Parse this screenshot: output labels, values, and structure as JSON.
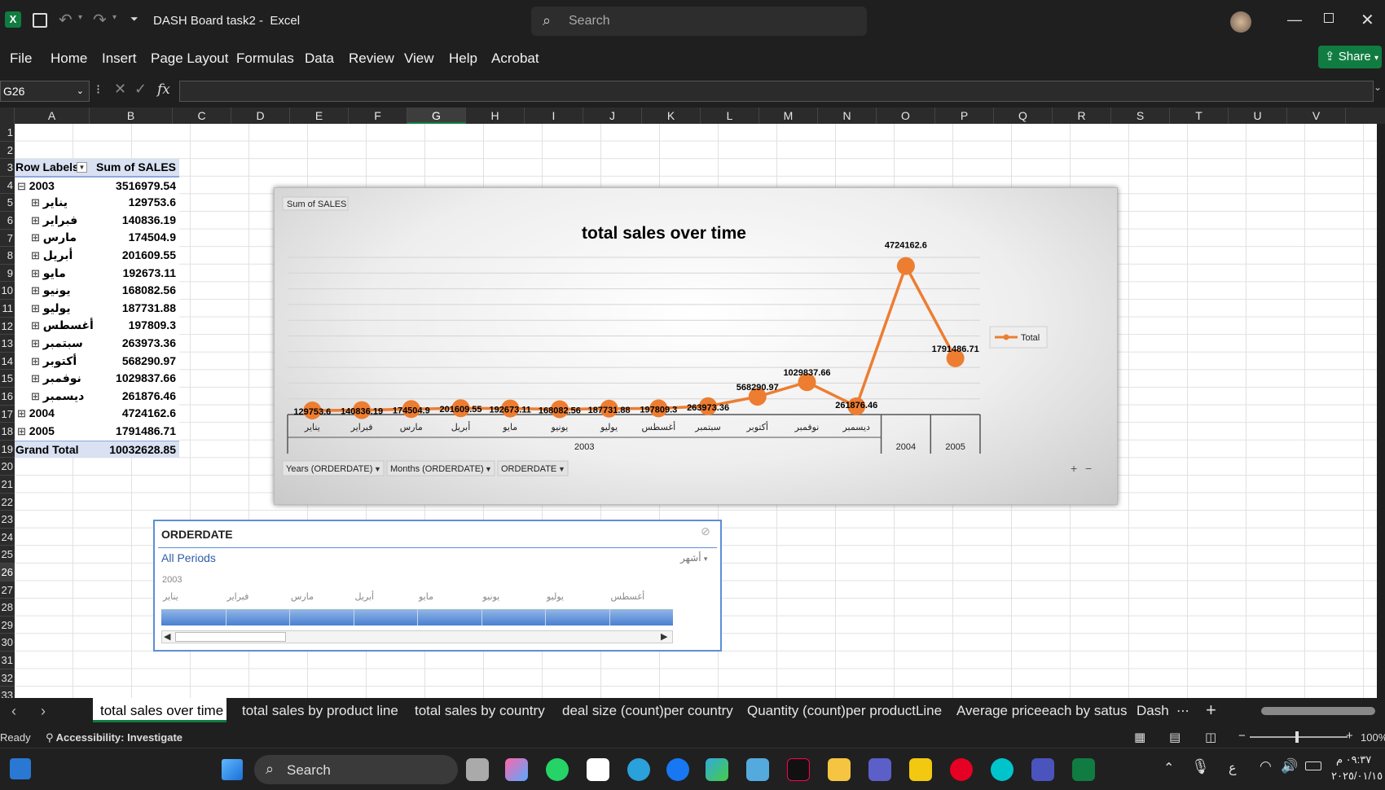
{
  "window": {
    "doc_title": "DASH Board task2",
    "app_name": "Excel",
    "search_placeholder": "Search",
    "share_label": "Share"
  },
  "ribbon": {
    "tabs": [
      "File",
      "Home",
      "Insert",
      "Page Layout",
      "Formulas",
      "Data",
      "Review",
      "View",
      "Help",
      "Acrobat"
    ]
  },
  "formula_bar": {
    "name_box": "G26",
    "fx_label": "fx",
    "value": ""
  },
  "columns": [
    "A",
    "B",
    "C",
    "D",
    "E",
    "F",
    "G",
    "H",
    "I",
    "J",
    "K",
    "L",
    "M",
    "N",
    "O",
    "P",
    "Q",
    "R",
    "S",
    "T",
    "U",
    "V"
  ],
  "selected_column": "G",
  "rows": [
    "1",
    "2",
    "3",
    "4",
    "5",
    "6",
    "7",
    "8",
    "9",
    "10",
    "11",
    "12",
    "13",
    "14",
    "15",
    "16",
    "17",
    "18",
    "19",
    "20",
    "21",
    "22",
    "23",
    "24",
    "25",
    "26",
    "27",
    "28",
    "29",
    "30",
    "31",
    "32",
    "33"
  ],
  "pivot": {
    "header_label": "Row Labels",
    "header_value": "Sum of SALES",
    "rows": [
      {
        "label": "2003",
        "value": "3516979.54",
        "level": 0,
        "toggle": "⊟"
      },
      {
        "label": "يناير",
        "value": "129753.6",
        "level": 1,
        "toggle": "⊞"
      },
      {
        "label": "فبراير",
        "value": "140836.19",
        "level": 1,
        "toggle": "⊞"
      },
      {
        "label": "مارس",
        "value": "174504.9",
        "level": 1,
        "toggle": "⊞"
      },
      {
        "label": "أبريل",
        "value": "201609.55",
        "level": 1,
        "toggle": "⊞"
      },
      {
        "label": "مايو",
        "value": "192673.11",
        "level": 1,
        "toggle": "⊞"
      },
      {
        "label": "يونيو",
        "value": "168082.56",
        "level": 1,
        "toggle": "⊞"
      },
      {
        "label": "يوليو",
        "value": "187731.88",
        "level": 1,
        "toggle": "⊞"
      },
      {
        "label": "أغسطس",
        "value": "197809.3",
        "level": 1,
        "toggle": "⊞"
      },
      {
        "label": "سبتمبر",
        "value": "263973.36",
        "level": 1,
        "toggle": "⊞"
      },
      {
        "label": "أكتوبر",
        "value": "568290.97",
        "level": 1,
        "toggle": "⊞"
      },
      {
        "label": "نوفمبر",
        "value": "1029837.66",
        "level": 1,
        "toggle": "⊞"
      },
      {
        "label": "ديسمبر",
        "value": "261876.46",
        "level": 1,
        "toggle": "⊞"
      },
      {
        "label": "2004",
        "value": "4724162.6",
        "level": 0,
        "toggle": "⊞"
      },
      {
        "label": "2005",
        "value": "1791486.71",
        "level": 0,
        "toggle": "⊞"
      }
    ],
    "grand_label": "Grand Total",
    "grand_value": "10032628.85"
  },
  "chart_data": {
    "type": "line",
    "title": "total sales over time",
    "field_button": "Sum of SALES",
    "categories": [
      "يناير",
      "فبراير",
      "مارس",
      "أبريل",
      "مايو",
      "يونيو",
      "يوليو",
      "أغسطس",
      "سبتمبر",
      "أكتوبر",
      "نوفمبر",
      "ديسمبر",
      "2004",
      "2005"
    ],
    "category_groups": [
      {
        "label": "2003",
        "span": 12
      },
      {
        "label": "2004",
        "span": 1
      },
      {
        "label": "2005",
        "span": 1
      }
    ],
    "series": [
      {
        "name": "Total",
        "color": "#ed7d31",
        "values": [
          129753.6,
          140836.19,
          174504.9,
          201609.55,
          192673.11,
          168082.56,
          187731.88,
          197809.3,
          263973.36,
          568290.97,
          1029837.66,
          261876.46,
          4724162.6,
          1791486.71
        ],
        "labels": [
          "129753.6",
          "140836.19",
          "174504.9",
          "201609.55",
          "192673.11",
          "168082.56",
          "187731.88",
          "197809.3",
          "263973.36",
          "568290.97",
          "1029837.66",
          "261876.46",
          "4724162.6",
          "1791486.71"
        ]
      }
    ],
    "ylim": [
      0,
      5000000
    ],
    "grid": true,
    "legend": "right",
    "axis_buttons": [
      "Years (ORDERDATE)",
      "Months (ORDERDATE)",
      "ORDERDATE"
    ]
  },
  "slicer": {
    "title": "ORDERDATE",
    "all_periods": "All Periods",
    "level": "أشهر",
    "year": "2003",
    "months": [
      "يناير",
      "فبراير",
      "مارس",
      "أبريل",
      "مايو",
      "يونيو",
      "يوليو",
      "أغسطس"
    ]
  },
  "sheet_tabs": [
    "total sales over time",
    "total sales by product line",
    "total sales by country",
    "deal size (count)per country",
    "Quantity (count)per productLine",
    "Average priceeach by satus",
    "Dash"
  ],
  "active_tab": 0,
  "status": {
    "ready": "Ready",
    "accessibility": "Accessibility: Investigate",
    "zoom": "100%"
  },
  "taskbar": {
    "search": "Search",
    "time": "٠٩:٣٧ م",
    "date": "٢٠٢٥/٠١/١٥",
    "lang": "ع"
  },
  "colors": {
    "accent": "#107c41",
    "line": "#ed7d31",
    "pivot_header": "#d9e1f2",
    "slicer_blue": "#5b8fd6"
  }
}
